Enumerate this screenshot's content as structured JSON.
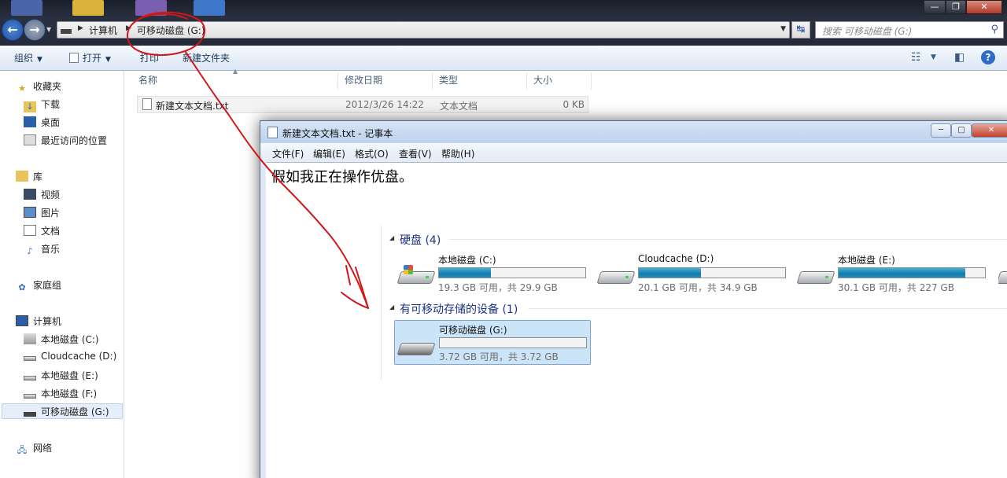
{
  "window_controls": {
    "minimize": "—",
    "maximize": "❐",
    "close": "✕"
  },
  "address": {
    "crumbs": [
      "计算机",
      "可移动磁盘 (G:)"
    ],
    "search_placeholder": "搜索 可移动磁盘 (G:)"
  },
  "toolbar": {
    "organize": "组织",
    "open": "打开",
    "print": "打印",
    "new_folder": "新建文件夹"
  },
  "nav": {
    "favorites": "收藏夹",
    "favorites_items": [
      "下载",
      "桌面",
      "最近访问的位置"
    ],
    "libraries": "库",
    "libraries_items": [
      "视频",
      "图片",
      "文档",
      "音乐"
    ],
    "homegroup": "家庭组",
    "computer": "计算机",
    "computer_items": [
      "本地磁盘 (C:)",
      "Cloudcache (D:)",
      "本地磁盘 (E:)",
      "本地磁盘 (F:)",
      "可移动磁盘 (G:)"
    ],
    "network": "网络"
  },
  "file_list": {
    "columns": [
      "名称",
      "修改日期",
      "类型",
      "大小"
    ],
    "rows": [
      {
        "name": "新建文本文档.txt",
        "modified": "2012/3/26 14:22",
        "type": "文本文档",
        "size": "0 KB"
      }
    ]
  },
  "notepad": {
    "title": "新建文本文档.txt - 记事本",
    "menu": [
      "文件(F)",
      "编辑(E)",
      "格式(O)",
      "查看(V)",
      "帮助(H)"
    ],
    "content": "假如我正在操作优盘。"
  },
  "computer_view": {
    "hard_disks_header": "硬盘 (4)",
    "drives": [
      {
        "name": "本地磁盘 (C:)",
        "caption": "19.3 GB 可用，共 29.9 GB",
        "used_fraction": 0.355
      },
      {
        "name": "Cloudcache (D:)",
        "caption": "20.1 GB 可用，共 34.9 GB",
        "used_fraction": 0.424
      },
      {
        "name": "本地磁盘 (E:)",
        "caption": "30.1 GB 可用，共 227 GB",
        "used_fraction": 0.867
      }
    ],
    "removable_header": "有可移动存储的设备 (1)",
    "removable": {
      "name": "可移动磁盘 (G:)",
      "caption": "3.72 GB 可用，共 3.72 GB",
      "used_fraction": 0.0
    }
  },
  "colors": {
    "annotation": "#d01818",
    "bar_fill": "#1b8fc2",
    "group_header": "#1e3287",
    "selection": "#cce4f7"
  }
}
